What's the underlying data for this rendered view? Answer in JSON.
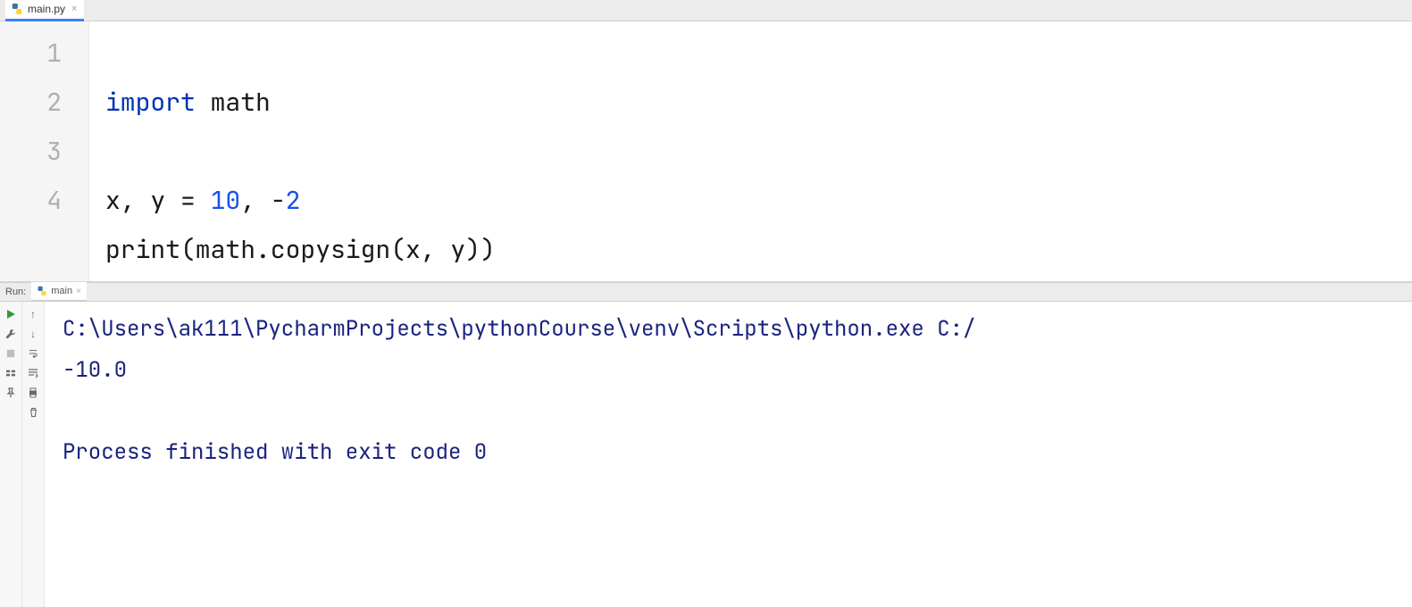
{
  "editor": {
    "tab": {
      "filename": "main.py"
    },
    "gutter": [
      "1",
      "2",
      "3",
      "4"
    ],
    "code": {
      "line1": {
        "kw": "import",
        "mod": "math"
      },
      "line3": {
        "vars": "x, y = ",
        "n1": "10",
        "sep": ", -",
        "n2": "2"
      },
      "line4": {
        "pre": "print(math.copysign(x, y))"
      }
    }
  },
  "run": {
    "label": "Run:",
    "tab": "main",
    "console": {
      "cmd": "C:\\Users\\ak111\\PycharmProjects\\pythonCourse\\venv\\Scripts\\python.exe C:/",
      "out1": "-10.0",
      "blank": "",
      "exit": "Process finished with exit code 0"
    }
  }
}
